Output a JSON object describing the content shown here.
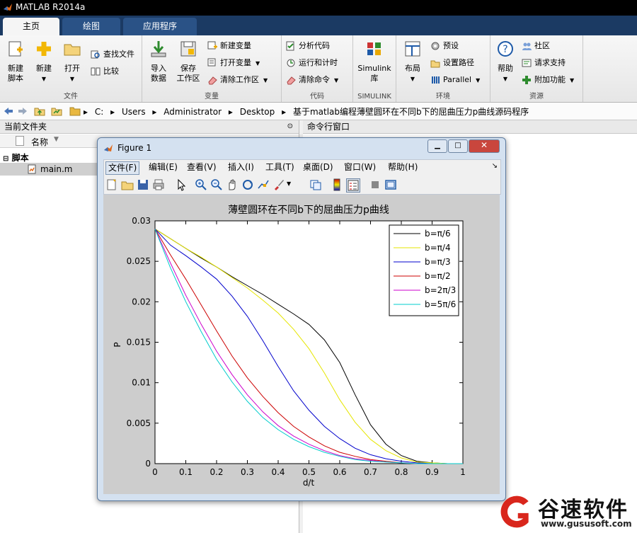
{
  "app": {
    "title": "MATLAB R2014a"
  },
  "ribbon_tabs": [
    "主页",
    "绘图",
    "应用程序"
  ],
  "ribbon": {
    "file": {
      "label": "文件",
      "new_script": "新建\n脚本",
      "new": "新建",
      "open": "打开",
      "find_files": "查找文件",
      "compare": "比较"
    },
    "variable": {
      "label": "变量",
      "import": "导入\n数据",
      "save_ws": "保存\n工作区",
      "new_var": "新建变量",
      "open_var": "打开变量",
      "clear_ws": "清除工作区"
    },
    "code": {
      "label": "代码",
      "analyze": "分析代码",
      "run_time": "运行和计时",
      "clear_cmd": "清除命令"
    },
    "simulink": {
      "label": "SIMULINK",
      "lib": "Simulink\n库"
    },
    "env": {
      "label": "环境",
      "layout": "布局",
      "prefs": "预设",
      "set_path": "设置路径",
      "parallel": "Parallel"
    },
    "resources": {
      "label": "资源",
      "help": "帮助",
      "community": "社区",
      "support": "请求支持",
      "addons": "附加功能"
    }
  },
  "breadcrumbs": [
    "C:",
    "Users",
    "Administrator",
    "Desktop",
    "基于matlab编程薄壁圆环在不同b下的屈曲压力p曲线源码程序"
  ],
  "file_pane": {
    "title": "当前文件夹",
    "column_name": "名称",
    "group": "脚本",
    "file": "main.m"
  },
  "cmd_pane": {
    "title": "命令行窗口"
  },
  "figure": {
    "title": "Figure 1",
    "menu": [
      "文件(F)",
      "编辑(E)",
      "查看(V)",
      "插入(I)",
      "工具(T)",
      "桌面(D)",
      "窗口(W)",
      "帮助(H)"
    ]
  },
  "chart_data": {
    "type": "line",
    "title": "薄壁圆环在不同b下的屈曲压力p曲线",
    "xlabel": "d/t",
    "ylabel": "P",
    "xlim": [
      0,
      1
    ],
    "ylim": [
      0,
      0.03
    ],
    "xticks": [
      "0",
      "0.1",
      "0.2",
      "0.3",
      "0.4",
      "0.5",
      "0.6",
      "0.7",
      "0.8",
      "0.9",
      "1"
    ],
    "yticks": [
      "0",
      "0.005",
      "0.01",
      "0.015",
      "0.02",
      "0.025",
      "0.03"
    ],
    "legend_position": "top-right",
    "x": [
      0,
      0.05,
      0.1,
      0.15,
      0.2,
      0.25,
      0.3,
      0.35,
      0.4,
      0.45,
      0.5,
      0.55,
      0.6,
      0.65,
      0.7,
      0.75,
      0.8,
      0.85,
      0.9,
      0.95,
      1
    ],
    "series": [
      {
        "name": "b=π/6",
        "color": "#000000",
        "values": [
          0.029,
          0.0278,
          0.0266,
          0.0254,
          0.0243,
          0.0231,
          0.022,
          0.0209,
          0.0197,
          0.0185,
          0.0172,
          0.0153,
          0.0125,
          0.0085,
          0.0048,
          0.0024,
          0.001,
          0.0003,
          0.0001,
          0,
          0
        ]
      },
      {
        "name": "b=π/4",
        "color": "#e6e600",
        "values": [
          0.029,
          0.0278,
          0.0266,
          0.0255,
          0.0243,
          0.023,
          0.0217,
          0.0202,
          0.0186,
          0.0166,
          0.0142,
          0.0112,
          0.0079,
          0.0051,
          0.003,
          0.0016,
          0.0007,
          0.0002,
          0.0001,
          0,
          0
        ]
      },
      {
        "name": "b=π/3",
        "color": "#0000cc",
        "values": [
          0.029,
          0.027,
          0.0257,
          0.0243,
          0.0228,
          0.0207,
          0.0182,
          0.0152,
          0.012,
          0.009,
          0.0066,
          0.0046,
          0.0031,
          0.0019,
          0.0011,
          0.0006,
          0.0003,
          0.0001,
          0,
          0,
          0
        ]
      },
      {
        "name": "b=π/2",
        "color": "#cc0000",
        "values": [
          0.029,
          0.0258,
          0.0228,
          0.0196,
          0.0164,
          0.0133,
          0.0106,
          0.0083,
          0.0063,
          0.0046,
          0.0033,
          0.0022,
          0.0014,
          0.0009,
          0.0005,
          0.0003,
          0.0001,
          0,
          0,
          0,
          0
        ]
      },
      {
        "name": "b=2π/3",
        "color": "#cc00cc",
        "values": [
          0.029,
          0.0248,
          0.0208,
          0.0172,
          0.0139,
          0.011,
          0.0085,
          0.0064,
          0.0047,
          0.0034,
          0.0024,
          0.0016,
          0.001,
          0.0006,
          0.0004,
          0.0002,
          0.0001,
          0,
          0,
          0,
          0
        ]
      },
      {
        "name": "b=5π/6",
        "color": "#00cccc",
        "values": [
          0.029,
          0.0242,
          0.02,
          0.0163,
          0.0129,
          0.0101,
          0.0077,
          0.0057,
          0.0042,
          0.003,
          0.0021,
          0.0014,
          0.0009,
          0.0005,
          0.0003,
          0.0002,
          0.0001,
          0,
          0,
          0,
          0
        ]
      }
    ]
  },
  "watermark": {
    "brand": "谷速软件",
    "url": "www.gususoft.com"
  }
}
